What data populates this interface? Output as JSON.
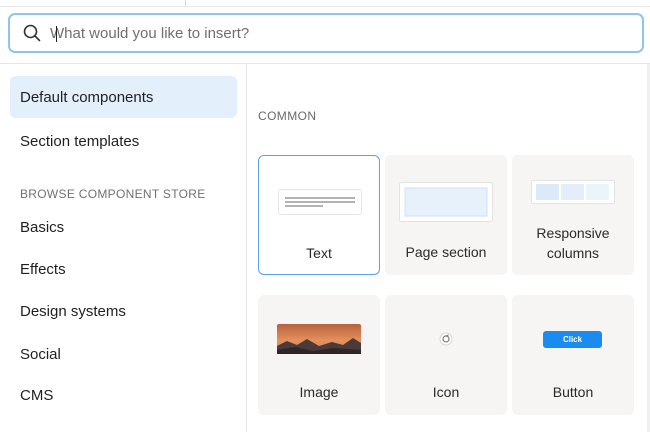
{
  "search": {
    "placeholder": "What would you like to insert?",
    "value": ""
  },
  "sidebar": {
    "items": [
      {
        "label": "Default components",
        "active": true
      },
      {
        "label": "Section templates",
        "active": false
      }
    ],
    "store_heading": "BROWSE COMPONENT STORE",
    "store_items": [
      {
        "label": "Basics"
      },
      {
        "label": "Effects"
      },
      {
        "label": "Design systems"
      },
      {
        "label": "Social"
      },
      {
        "label": "CMS"
      }
    ]
  },
  "content": {
    "section_label": "COMMON",
    "cards": [
      {
        "label": "Text",
        "icon": "text-lines-icon",
        "selected": true
      },
      {
        "label": "Page section",
        "icon": "page-section-icon",
        "selected": false
      },
      {
        "label_line1": "Responsive",
        "label_line2": "columns",
        "icon": "columns-icon",
        "selected": false
      },
      {
        "label": "Image",
        "icon": "landscape-image-icon",
        "selected": false
      },
      {
        "label": "Icon",
        "icon": "small-icon",
        "selected": false
      },
      {
        "label": "Button",
        "icon": "button-icon",
        "button_text": "Click",
        "selected": false
      }
    ]
  },
  "colors": {
    "accent": "#1a8cf0",
    "active_bg": "#e3effb",
    "card_bg": "#f6f5f3",
    "focus_border": "#8ec5ef"
  }
}
